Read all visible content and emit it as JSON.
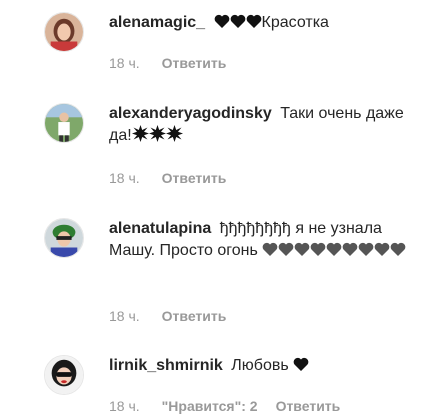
{
  "comments": [
    {
      "username": "alenamagic_",
      "text_after": "Красотка",
      "time": "18 ч.",
      "reply_label": "Ответить"
    },
    {
      "username": "alexanderyagodinsky",
      "text": "Таки очень даже да!",
      "time": "18 ч.",
      "reply_label": "Ответить"
    },
    {
      "username": "alenatulapina",
      "text": "ђђђђђђђђ я не узнала Машу. Просто огонь",
      "time": "18 ч.",
      "reply_label": "Ответить"
    },
    {
      "username": "lirnik_shmirnik",
      "text": "Любовь",
      "time": "18 ч.",
      "likes": "\"Нравится\": 2",
      "reply_label": "Ответить"
    }
  ],
  "icons": {
    "heart_black": "heart-icon",
    "heart_grey": "grey-heart-icon",
    "burst": "burst-emoji-icon"
  },
  "colors": {
    "text": "#262626",
    "meta": "#999999",
    "heart_black": "#111111",
    "heart_grey": "#555555"
  }
}
